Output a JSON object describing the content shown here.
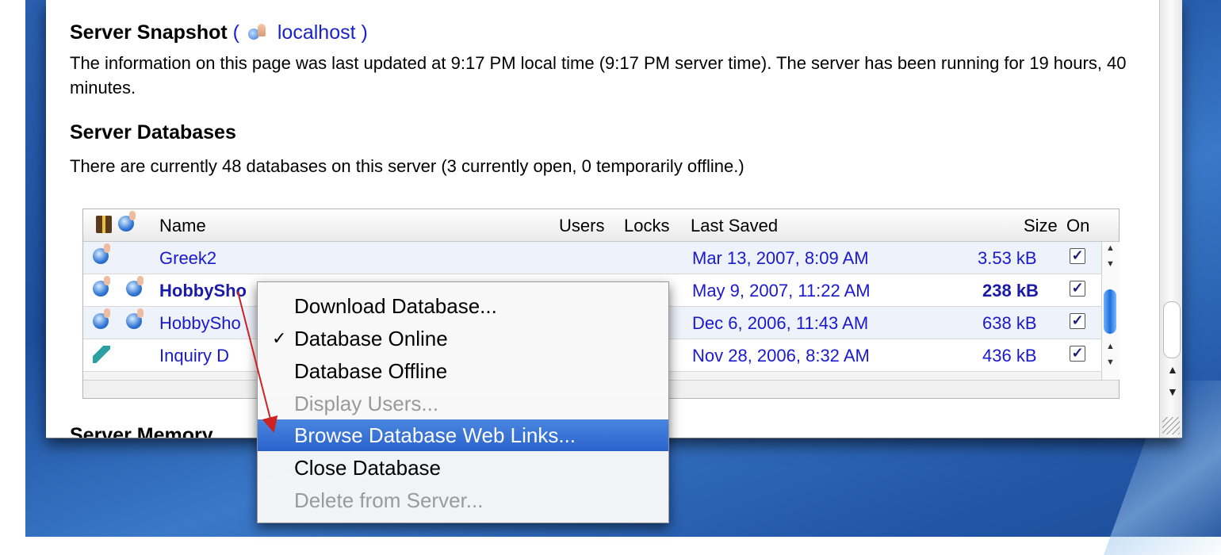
{
  "snapshot": {
    "title": "Server Snapshot",
    "paren_open": "(",
    "host": "localhost",
    "paren_close": ")",
    "info": "The information on this page was last updated at 9:17 PM local time (9:17 PM server time). The server has been running for 19 hours, 40 minutes."
  },
  "databases": {
    "title": "Server Databases",
    "summary": "There are currently 48 databases on this server (3 currently open, 0 temporarily offline.)",
    "columns": {
      "name": "Name",
      "users": "Users",
      "locks": "Locks",
      "last_saved": "Last Saved",
      "size": "Size",
      "on": "On"
    },
    "rows": [
      {
        "name": "Greek2",
        "last_saved": "Mar 13, 2007, 8:09 AM",
        "size": "3.53 kB",
        "on": "✓"
      },
      {
        "name": "HobbySho",
        "last_saved": "May 9, 2007, 11:22 AM",
        "size": "238 kB",
        "on": "✓"
      },
      {
        "name": "HobbySho",
        "last_saved": "Dec 6, 2006, 11:43 AM",
        "size": "638 kB",
        "on": "✓"
      },
      {
        "name": "Inquiry D",
        "last_saved": "Nov 28, 2006, 8:32 AM",
        "size": "436 kB",
        "on": "✓"
      }
    ]
  },
  "next_section_partial": "Server Memory",
  "context_menu": {
    "items": [
      {
        "label": "Download Database...",
        "state": "enabled"
      },
      {
        "label": "Database Online",
        "state": "enabled",
        "check": "✓"
      },
      {
        "label": "Database Offline",
        "state": "enabled"
      },
      {
        "label": "Display Users...",
        "state": "disabled"
      },
      {
        "label": "Browse Database Web Links...",
        "state": "selected"
      },
      {
        "label": "Close Database",
        "state": "enabled"
      },
      {
        "label": "Delete from Server...",
        "state": "disabled"
      }
    ]
  },
  "colors": {
    "link": "#1a22c8",
    "selection": "#2a63cc",
    "arrow": "#cc2222",
    "desktop": "#2459a8"
  },
  "icons": [
    "host-icon",
    "gift-icon",
    "globe-icon",
    "feather-icon",
    "checkbox-icon"
  ]
}
